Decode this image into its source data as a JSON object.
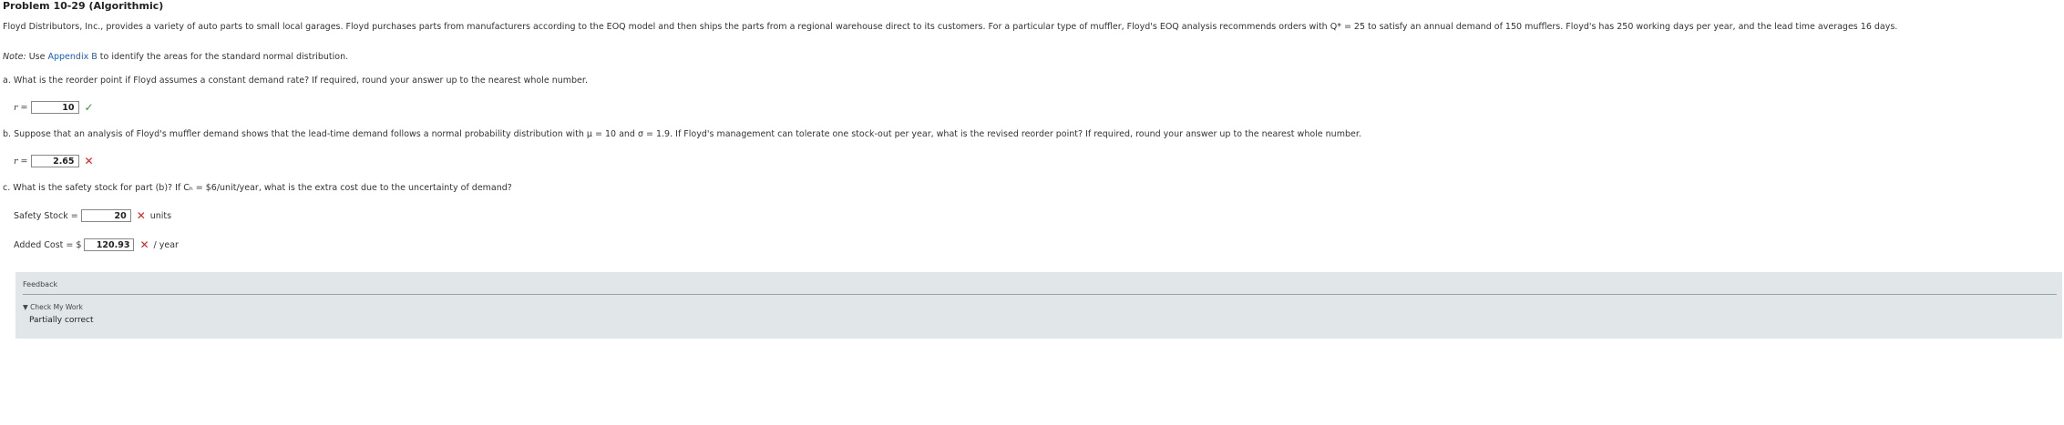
{
  "problem": {
    "title": "Problem 10-29 (Algorithmic)",
    "intro": "Floyd Distributors, Inc., provides a variety of auto parts to small local garages. Floyd purchases parts from manufacturers according to the EOQ model and then ships the parts from a regional warehouse direct to its customers. For a particular type of muffler, Floyd's EOQ analysis recommends orders with Q* = 25 to satisfy an annual demand of 150 mufflers. Floyd's has 250 working days per year, and the lead time averages 16 days.",
    "note_prefix": "Note:",
    "note_pre_link": " Use ",
    "note_link": "Appendix B",
    "note_post_link": " to identify the areas for the standard normal distribution."
  },
  "part_a": {
    "question": "a. What is the reorder point if Floyd assumes a constant demand rate? If required, round your answer up to the nearest whole number.",
    "label": "r =",
    "value": "10",
    "status": "correct",
    "mark": "✓"
  },
  "part_b": {
    "question": "b. Suppose that an analysis of Floyd's muffler demand shows that the lead-time demand follows a normal probability distribution with μ = 10 and σ = 1.9. If Floyd's management can tolerate one stock-out per year, what is the revised reorder point? If required, round your answer up to the nearest whole number.",
    "label": "r =",
    "value": "2.65",
    "status": "incorrect",
    "mark": "✕"
  },
  "part_c": {
    "question": "c. What is the safety stock for part (b)? If Cₕ = $6/unit/year, what is the extra cost due to the uncertainty of demand?",
    "safety_label": "Safety Stock =",
    "safety_value": "20",
    "safety_mark": "✕",
    "safety_unit": "units",
    "cost_label": "Added Cost = $",
    "cost_value": "120.93",
    "cost_mark": "✕",
    "cost_unit": "/ year"
  },
  "feedback": {
    "title": "Feedback",
    "toggle": "▼ Check My Work",
    "status": "Partially correct"
  },
  "colors": {
    "correct": "#2e9a2e",
    "incorrect": "#dd2222",
    "link": "#1a5fb4",
    "feedback_bg": "#e1e6e9"
  }
}
